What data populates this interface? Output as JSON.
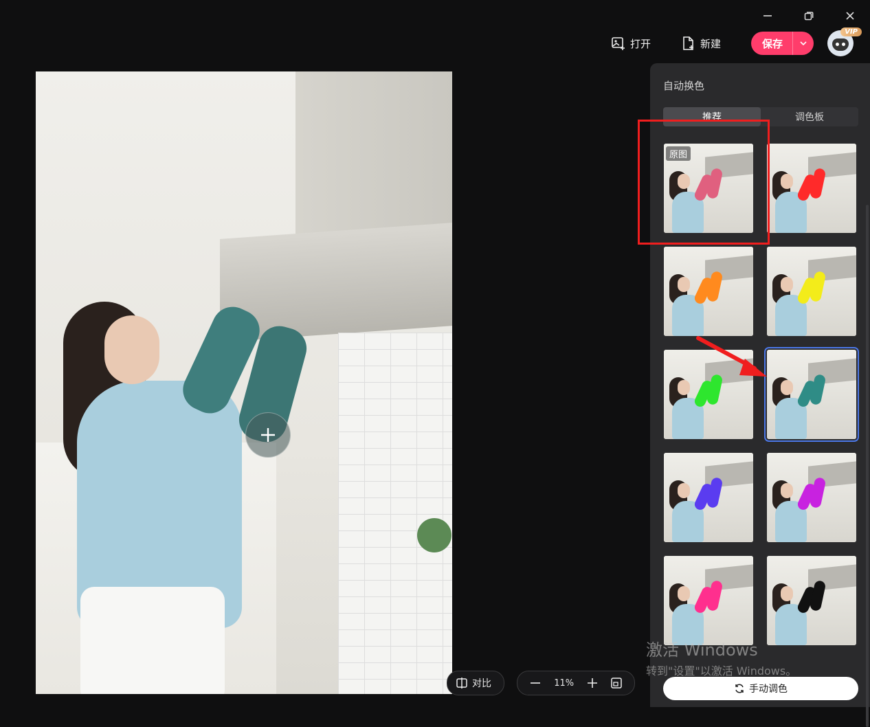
{
  "toolbar": {
    "open_label": "打开",
    "new_label": "新建",
    "save_label": "保存",
    "vip_badge": "VIP"
  },
  "panel": {
    "title": "自动换色",
    "tabs": [
      {
        "label": "推荐",
        "active": true
      },
      {
        "label": "调色板",
        "active": false
      }
    ],
    "original_label": "原图",
    "swatches": [
      {
        "glove_color": "#e0607f",
        "selected": false
      },
      {
        "glove_color": "#ff2a2a",
        "selected": false
      },
      {
        "glove_color": "#ff8a1e",
        "selected": false
      },
      {
        "glove_color": "#f3ec1a",
        "selected": false
      },
      {
        "glove_color": "#2ee62e",
        "selected": false
      },
      {
        "glove_color": "#2f8c86",
        "selected": true
      },
      {
        "glove_color": "#5a3cf0",
        "selected": false
      },
      {
        "glove_color": "#c822e0",
        "selected": false
      },
      {
        "glove_color": "#ff2f8e",
        "selected": false
      },
      {
        "glove_color": "#111111",
        "selected": false
      }
    ],
    "manual_label": "手动调色"
  },
  "bottom": {
    "compare_label": "对比",
    "zoom_value": "11%"
  },
  "watermark": {
    "line1": "激活 Windows",
    "line2": "转到\"设置\"以激活 Windows。"
  },
  "colors": {
    "accent": "#ff3d6b",
    "selection": "#4c78e8",
    "annotation": "#f01e1e"
  }
}
